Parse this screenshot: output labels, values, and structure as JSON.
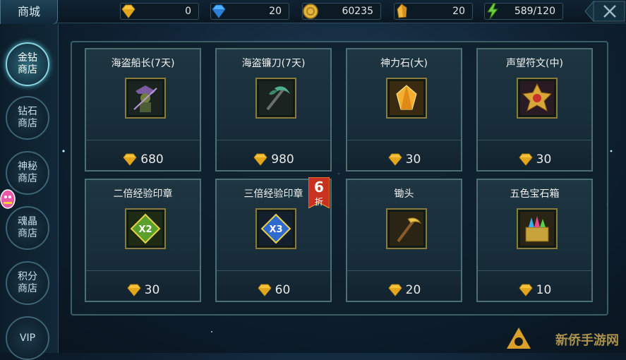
{
  "header": {
    "title": "商城",
    "currencies": [
      {
        "icon": "gold-diamond-icon",
        "value": "0"
      },
      {
        "icon": "blue-diamond-icon",
        "value": "20"
      },
      {
        "icon": "gold-coin-icon",
        "value": "60235"
      },
      {
        "icon": "crystal-icon",
        "value": "20"
      },
      {
        "icon": "stamina-icon",
        "value": "589/120"
      }
    ]
  },
  "sidebar": {
    "tabs": [
      {
        "label": "金钻商店",
        "active": true
      },
      {
        "label": "钻石商店",
        "active": false
      },
      {
        "label": "神秘商店",
        "active": false
      },
      {
        "label": "魂晶商店",
        "active": false
      },
      {
        "label": "积分商店",
        "active": false
      },
      {
        "label": "VIP",
        "active": false
      }
    ]
  },
  "items": [
    {
      "name": "海盗船长(7天)",
      "price": "680",
      "icon": "pirate-captain-icon"
    },
    {
      "name": "海盗镰刀(7天)",
      "price": "980",
      "icon": "pirate-scythe-icon"
    },
    {
      "name": "神力石(大)",
      "price": "30",
      "icon": "power-stone-icon"
    },
    {
      "name": "声望符文(中)",
      "price": "30",
      "icon": "prestige-rune-icon"
    },
    {
      "name": "二倍经验印章",
      "price": "30",
      "icon": "double-exp-seal-icon"
    },
    {
      "name": "三倍经验印章",
      "price": "60",
      "icon": "triple-exp-seal-icon"
    },
    {
      "name": "锄头",
      "price": "20",
      "icon": "hoe-icon"
    },
    {
      "name": "五色宝石箱",
      "price": "10",
      "icon": "gem-chest-icon"
    }
  ],
  "seal_labels": {
    "double": "X2",
    "triple": "X3"
  },
  "discount": {
    "number": "6",
    "label": "折"
  },
  "watermark": "新侨手游网",
  "colors": {
    "gold": "#f5c23a",
    "accent": "#8cd3e0",
    "discount_red": "#c8321e"
  }
}
